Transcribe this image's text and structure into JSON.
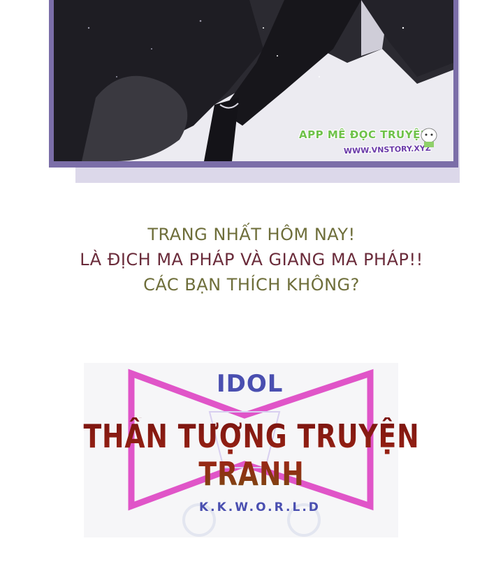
{
  "watermark": {
    "title": "APP MÊ ĐỌC TRUYỆN",
    "url": "WWW.VNSTORY.XYZ"
  },
  "announcement": {
    "line1": "TRANG NHẤT HÔM NAY!",
    "line2": "LÀ ĐỊCH MA PHÁP VÀ GIANG MA PHÁP!!",
    "line3": "CÁC BẠN THÍCH KHÔNG?"
  },
  "logo": {
    "top_text": "IDOL",
    "title": "THẦN TƯỢNG TRUYỆN TRANH",
    "bottom_text": "K.K.W.O.R.L.D"
  },
  "colors": {
    "panel_border": "#7b6ea8",
    "announce_olive": "#6e6e3a",
    "announce_maroon": "#6a2b3a",
    "logo_pink": "#e055c8",
    "logo_blue": "#4a4fb0",
    "title_red": "#8a1a12"
  }
}
